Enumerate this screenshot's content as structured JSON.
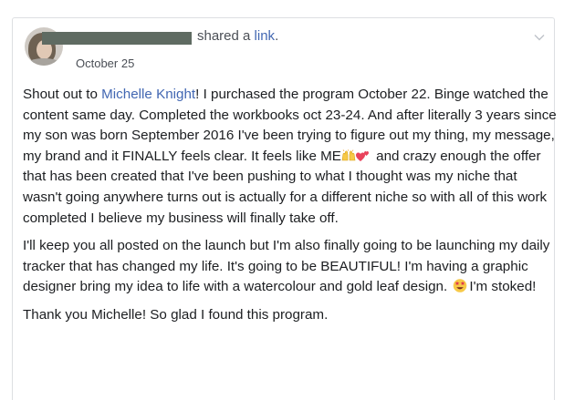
{
  "post": {
    "author_name": "",
    "action_text": "shared a ",
    "action_link": "link",
    "action_end": ".",
    "date": "October 25",
    "menu_icon": "chevron-down-icon",
    "paragraphs": {
      "p1": {
        "a": "Shout out to ",
        "mention": "Michelle Knight",
        "b": "! I purchased the program October 22. Binge watched the content same day. Completed the workbooks oct 23-24. And after literally 3 years since my son was born September 2016 I've been trying to figure out my thing, my message, my brand and it FINALLY feels clear. It feels like ME",
        "emoji1": "raising-hands-emoji",
        "emoji2": "two-hearts-emoji",
        "c": " and crazy enough the offer that has been created that I've been pushing to what I thought was my niche that wasn't going anywhere turns out is actually for a different niche so with all of this work completed I believe my business will finally take off."
      },
      "p2": {
        "a": "I'll keep you all posted on the launch but I'm also finally going to be launching my daily tracker that has changed my life. It's going to be BEAUTIFUL! I'm having a graphic designer bring my idea to life with a watercolour and gold leaf design.",
        "emoji": "star-struck-emoji",
        "b": "I'm stoked!"
      },
      "p3": "Thank you Michelle! So glad I found this program."
    }
  },
  "colors": {
    "link": "#4267b2",
    "text": "#1c1e21",
    "meta": "#4b4f56",
    "border": "#dddfe2"
  }
}
